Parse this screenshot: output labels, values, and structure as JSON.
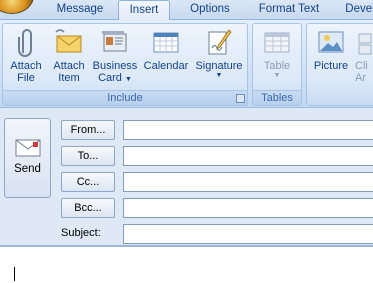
{
  "tabs": [
    {
      "label": "Message",
      "active": false
    },
    {
      "label": "Insert",
      "active": true
    },
    {
      "label": "Options",
      "active": false
    },
    {
      "label": "Format Text",
      "active": false
    },
    {
      "label": "Devel",
      "active": false
    }
  ],
  "ribbon": {
    "include": {
      "label": "Include",
      "buttons": [
        {
          "line1": "Attach",
          "line2": "File",
          "icon": "paperclip-icon"
        },
        {
          "line1": "Attach",
          "line2": "Item",
          "icon": "envelope-icon"
        },
        {
          "line1": "Business",
          "line2": "Card",
          "icon": "business-card-icon",
          "has_dropdown": true
        },
        {
          "line1": "Calendar",
          "line2": "",
          "icon": "calendar-icon"
        },
        {
          "line1": "Signature",
          "line2": "",
          "icon": "signature-icon",
          "has_dropdown": true
        }
      ]
    },
    "tables": {
      "label": "Tables",
      "buttons": [
        {
          "line1": "Table",
          "line2": "",
          "icon": "table-icon",
          "has_dropdown": true,
          "disabled": true
        }
      ]
    },
    "illustrations": {
      "buttons": [
        {
          "line1": "Picture",
          "line2": "",
          "icon": "picture-icon"
        },
        {
          "line1": "Cli",
          "line2": "Ar",
          "icon": "clip-art-icon",
          "disabled": true
        }
      ]
    }
  },
  "compose": {
    "send_label": "Send",
    "from_label": "From...",
    "to_label": "To...",
    "cc_label": "Cc...",
    "bcc_label": "Bcc...",
    "subject_label": "Subject:",
    "from_value": "",
    "to_value": "",
    "cc_value": "",
    "bcc_value": "",
    "subject_value": "",
    "body_text": ""
  },
  "colors": {
    "ribbon_text": "#15428b",
    "tab_strip": "#c7d9ef",
    "ribbon_bg": "#d2e2f5",
    "compose_bg": "#dfe9f6"
  }
}
